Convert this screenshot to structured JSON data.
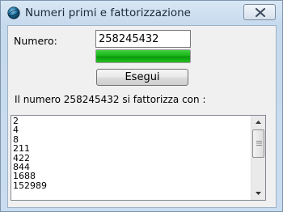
{
  "window": {
    "title": "Numeri primi e fattorizzazione",
    "icon": "app-sphere-icon",
    "close_icon": "close-icon"
  },
  "form": {
    "numero_label": "Numero:",
    "numero_value": "258245432",
    "progress_percent": 100,
    "progress_color": "#1cb51c",
    "esegui_label": "Esegui",
    "result_text": "Il numero 258245432 si fattorizza con :"
  },
  "list": {
    "items": [
      "2",
      "4",
      "8",
      "211",
      "422",
      "844",
      "1688",
      "152989"
    ]
  }
}
